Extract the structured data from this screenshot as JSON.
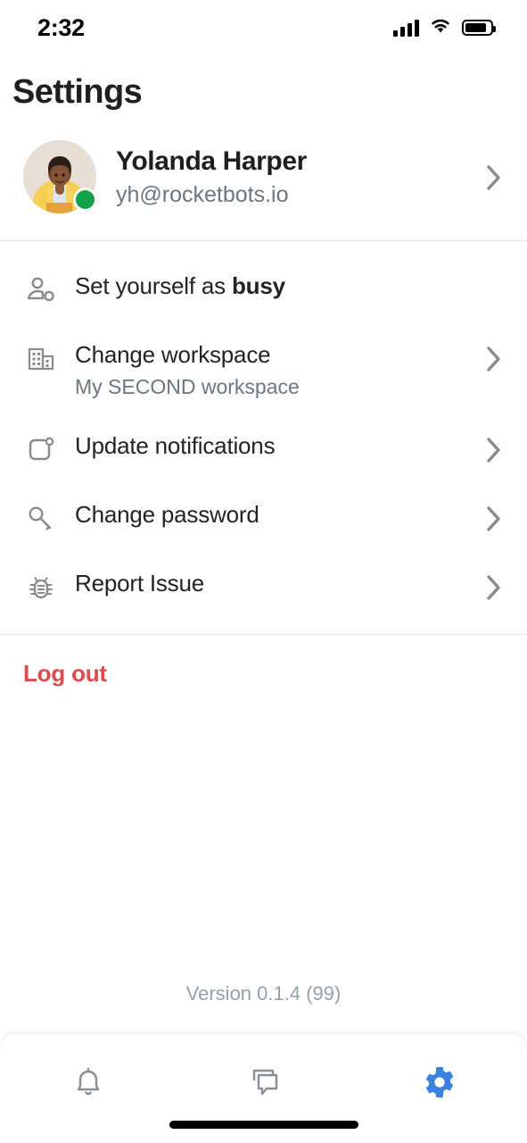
{
  "status_bar": {
    "time": "2:32",
    "cellular_icon": "cellular-signal-icon",
    "wifi_icon": "wifi-icon",
    "battery_icon": "battery-icon"
  },
  "header": {
    "title": "Settings"
  },
  "profile": {
    "name": "Yolanda Harper",
    "email": "yh@rocketbots.io",
    "online_status": "online",
    "online_color": "#13a24a",
    "chevron": "chevron-right-icon"
  },
  "menu": {
    "items": [
      {
        "id": "set-status-busy",
        "icon": "person-status-icon",
        "label_prefix": "Set yourself as ",
        "label_strong": "busy",
        "subtitle": "",
        "has_chevron": false
      },
      {
        "id": "change-workspace",
        "icon": "building-icon",
        "label_prefix": "Change workspace",
        "label_strong": "",
        "subtitle": "My SECOND workspace",
        "has_chevron": true
      },
      {
        "id": "update-notifications",
        "icon": "notification-badge-icon",
        "label_prefix": "Update notifications",
        "label_strong": "",
        "subtitle": "",
        "has_chevron": true
      },
      {
        "id": "change-password",
        "icon": "key-icon",
        "label_prefix": "Change password",
        "label_strong": "",
        "subtitle": "",
        "has_chevron": true
      },
      {
        "id": "report-issue",
        "icon": "bug-icon",
        "label_prefix": "Report Issue",
        "label_strong": "",
        "subtitle": "",
        "has_chevron": true
      }
    ]
  },
  "logout": {
    "label": "Log out",
    "color": "#e04a4c"
  },
  "footer": {
    "version": "Version 0.1.4 (99)"
  },
  "tabbar": {
    "items": [
      {
        "id": "notifications",
        "icon": "bell-icon",
        "active": false
      },
      {
        "id": "messages",
        "icon": "chat-bubbles-icon",
        "active": false
      },
      {
        "id": "settings",
        "icon": "gear-icon",
        "active": true
      }
    ],
    "active_color": "#3b82e0",
    "inactive_color": "#8b8f94"
  }
}
